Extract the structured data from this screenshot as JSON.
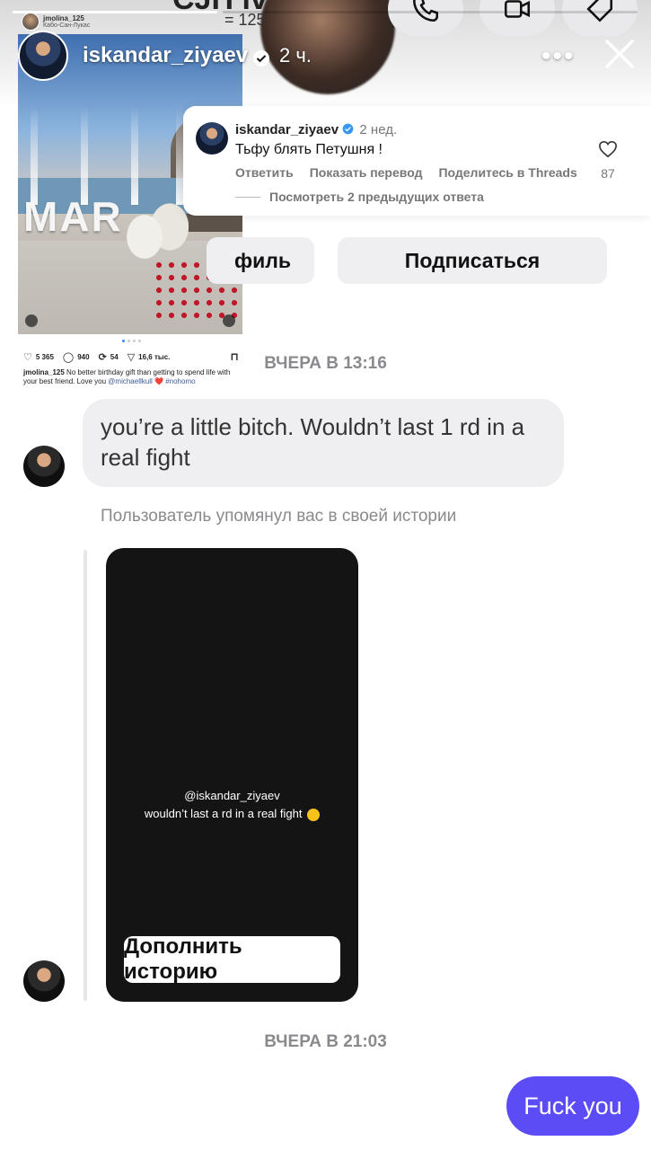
{
  "story": {
    "progress_segments": 3,
    "username": "iskandar_ziyaev",
    "time": "2 ч.",
    "more_label": "•••"
  },
  "contact": {
    "name_cut": "CJH iviulina",
    "sub": "= 125"
  },
  "embedded_post": {
    "user": "jmolina_125",
    "location": "Кабо-Сан-Лукас",
    "photo_text": "MAR",
    "stats": {
      "likes": "5 365",
      "comments": "940",
      "reposts": "54",
      "shares": "16,6 тыс."
    },
    "caption_user": "jmolina_125",
    "caption": "No better birthday gift than getting to spend life with your best friend. Love you",
    "caption_mention": "@michaellkull",
    "caption_heart": "❤️",
    "caption_tag": "#nohomo"
  },
  "comment": {
    "user": "iskandar_ziyaev",
    "time": "2 нед.",
    "text": "Тьфу блять Петушня !",
    "actions": [
      "Ответить",
      "Показать перевод",
      "Поделитесь в Threads"
    ],
    "likes": "87",
    "view_previous": "Посмотреть 2 предыдущих ответа"
  },
  "profile_buttons": {
    "profile": "филь",
    "subscribe": "Подписаться"
  },
  "chat": {
    "time_sep_1": "ВЧЕРА В 13:16",
    "incoming_message": "you’re a little bitch. Wouldn’t last 1 rd in a real fight",
    "mention_note": "Пользователь упомянул вас в своей истории",
    "story_mention": "@iskandar_ziyaev",
    "story_text": "wouldn’t last a rd in a real fight",
    "add_story_button": "Дополнить историю",
    "time_sep_2": "ВЧЕРА В 21:03",
    "outgoing_message": "Fuck you"
  },
  "colors": {
    "accent": "#5b4cf5",
    "bubble_incoming": "#efeff2",
    "verified": "#3897f0"
  }
}
